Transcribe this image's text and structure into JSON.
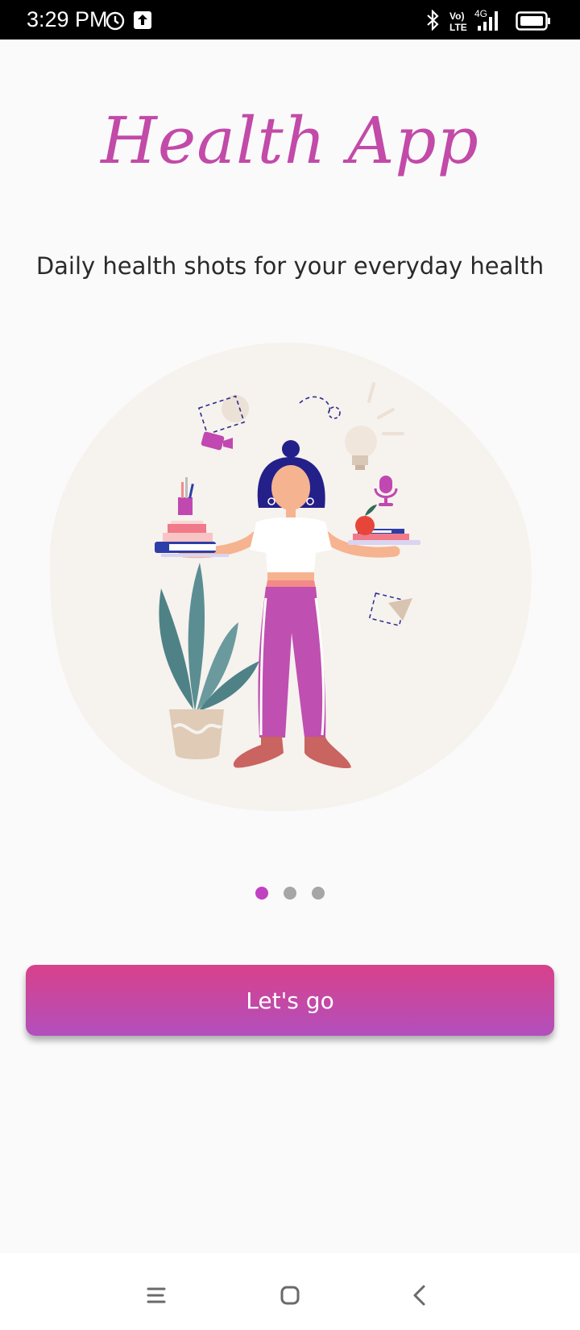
{
  "status_bar": {
    "time": "3:29 PM",
    "icons": [
      "alarm-icon",
      "upload-icon",
      "bluetooth-icon",
      "volte-icon",
      "signal-4g-icon",
      "battery-icon"
    ],
    "network_label": "4G",
    "volte_top": "Vo)",
    "volte_bottom": "LTE"
  },
  "app": {
    "title": "Health App",
    "tagline": "Daily health shots for your everyday health"
  },
  "pager": {
    "total": 3,
    "active_index": 0
  },
  "cta": {
    "label": "Let's go"
  },
  "colors": {
    "accent": "#c042c0",
    "title": "#c24aa8",
    "button_top": "#d8418a",
    "button_bottom": "#b24fbd",
    "blob": "#f6f2ee"
  },
  "nav_bar": {
    "items": [
      "menu-icon",
      "home-icon",
      "back-icon"
    ]
  }
}
